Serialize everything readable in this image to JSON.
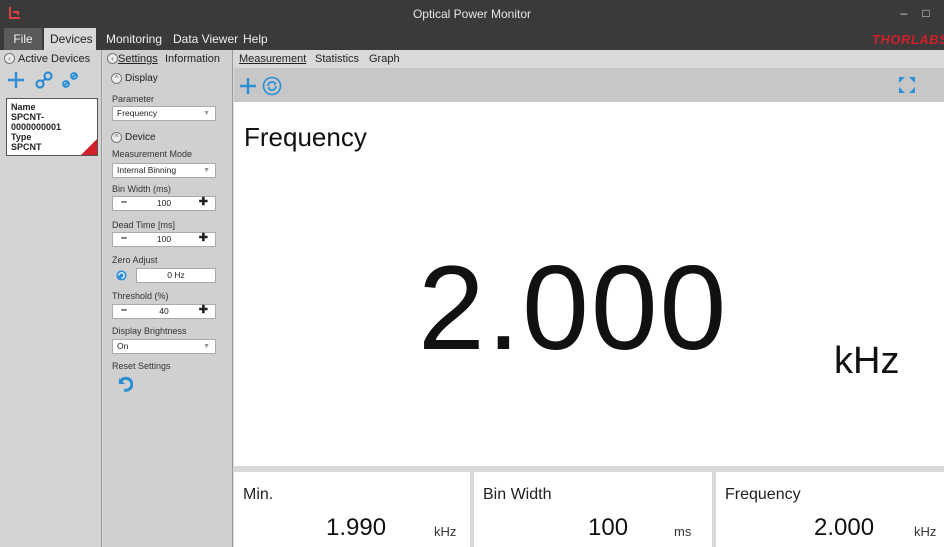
{
  "window": {
    "title": "Optical Power Monitor",
    "minimize_glyph": "–",
    "maximize_glyph": "□"
  },
  "menu": {
    "file": "File",
    "devices": "Devices",
    "monitoring": "Monitoring",
    "data_viewer": "Data Viewer",
    "help": "Help",
    "brand": "THORLABS"
  },
  "devices_panel": {
    "header": "Active Devices",
    "device": {
      "name_label": "Name",
      "name_value": "SPCNT-0000000001",
      "type_label": "Type",
      "type_value": "SPCNT"
    }
  },
  "settings": {
    "tabs": [
      "Settings",
      "Information"
    ],
    "display_section": "Display",
    "parameter_label": "Parameter",
    "parameter_value": "Frequency",
    "device_section": "Device",
    "measurement_mode_label": "Measurement Mode",
    "measurement_mode_value": "Internal Binning",
    "bin_width_label": "Bin Width (ms)",
    "bin_width_value": "100",
    "dead_time_label": "Dead Time [ms]",
    "dead_time_value": "100",
    "zero_adjust_label": "Zero Adjust",
    "zero_adjust_value": "0 Hz",
    "threshold_label": "Threshold (%)",
    "threshold_value": "40",
    "display_brightness_label": "Display Brightness",
    "display_brightness_value": "On",
    "reset_label": "Reset Settings",
    "minus": "–",
    "plus": "✚",
    "caret": "▼"
  },
  "main": {
    "tabs": [
      "Measurement",
      "Statistics",
      "Graph"
    ],
    "title": "Frequency",
    "value": "2.000",
    "unit": "kHz",
    "stats": [
      {
        "label": "Min.",
        "value": "1.990",
        "unit": "kHz"
      },
      {
        "label": "Bin Width",
        "value": "100",
        "unit": "ms"
      },
      {
        "label": "Frequency",
        "value": "2.000",
        "unit": "kHz"
      }
    ]
  },
  "colors": {
    "accent_blue": "#2a8fd4",
    "brand_red": "#d0202a",
    "titlebar": "#3a3a3a"
  },
  "icons": [
    "app-icon",
    "add-icon",
    "connect-icon",
    "disconnect-icon",
    "refresh-icon",
    "fullscreen-icon",
    "zero-adjust-icon",
    "undo-icon",
    "collapse-icon"
  ]
}
